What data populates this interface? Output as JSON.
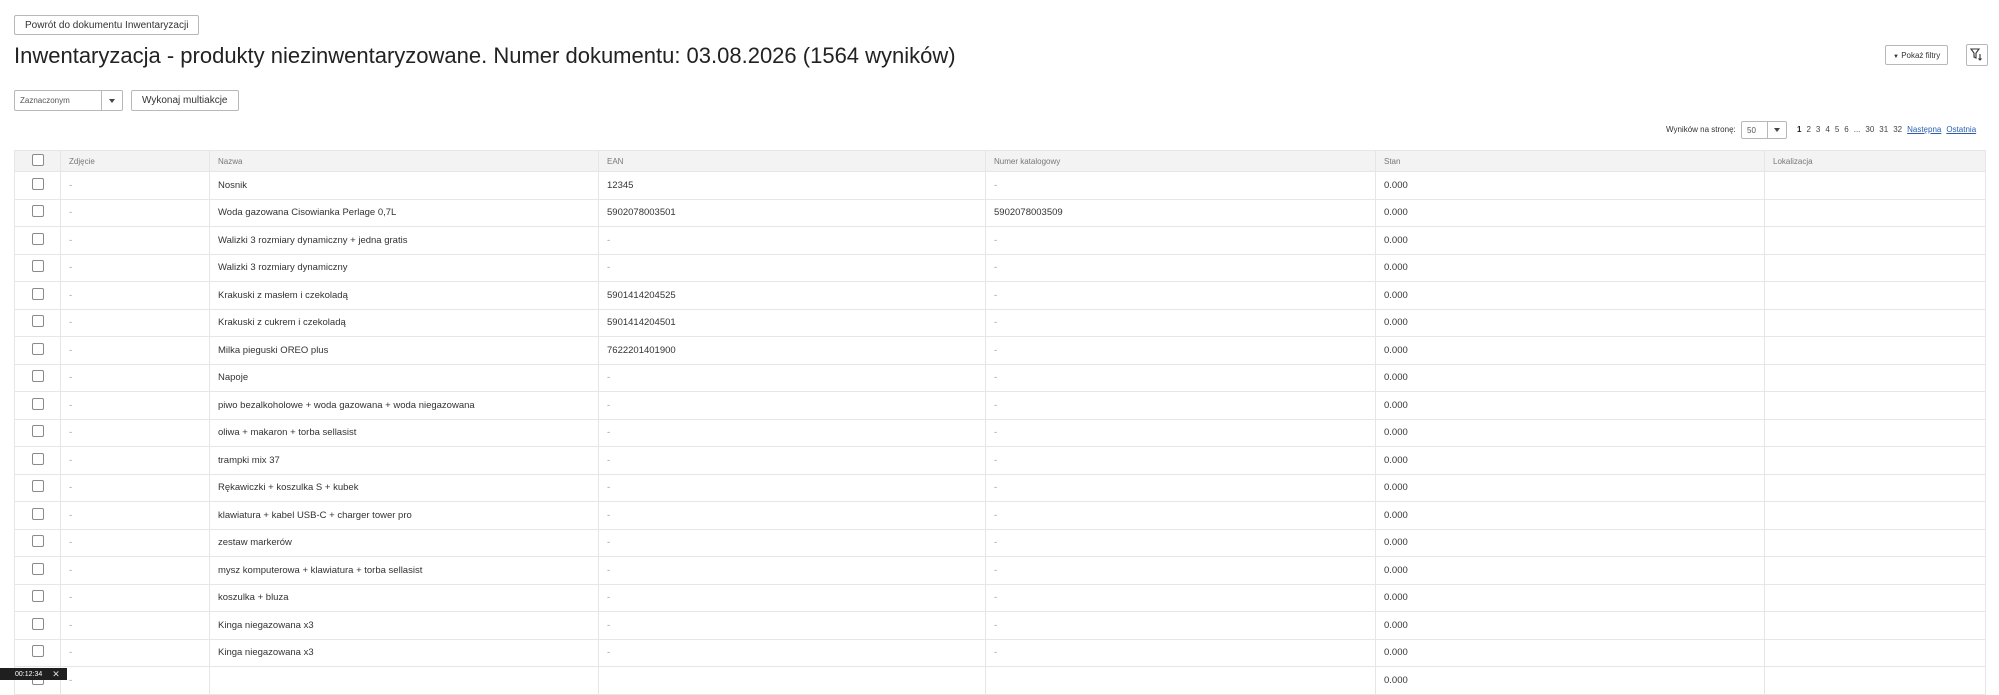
{
  "header": {
    "back_label": "Powrót do dokumentu Inwentaryzacji",
    "title": "Inwentaryzacja - produkty niezinwentaryzowane. Numer dokumentu: 03.08.2026 (1564 wyników)",
    "show_filters_label": "Pokaż filtry",
    "filter_icon": "filter-sort-icon"
  },
  "toolbar": {
    "mass_select_value": "Zaznaczonym",
    "multiaction_label": "Wykonaj multiakcje"
  },
  "pagination": {
    "per_page_label": "Wyników na stronę:",
    "per_page_value": "50",
    "pages": [
      "1",
      "2",
      "3",
      "4",
      "5",
      "6"
    ],
    "ellipsis": "...",
    "last_pages": [
      "30",
      "31",
      "32"
    ],
    "next_label": "Następna",
    "last_label": "Ostatnia"
  },
  "table": {
    "columns": [
      "Zdjęcie",
      "Nazwa",
      "EAN",
      "Numer katalogowy",
      "Stan",
      "Lokalizacja"
    ],
    "rows": [
      {
        "photo": "-",
        "name": "Nosnik",
        "ean": "12345",
        "catalog": "-",
        "stock": "0.000",
        "location": ""
      },
      {
        "photo": "-",
        "name": "Woda gazowana Cisowianka Perlage 0,7L",
        "ean": "5902078003501",
        "catalog": "5902078003509",
        "stock": "0.000",
        "location": ""
      },
      {
        "photo": "-",
        "name": "Walizki 3 rozmiary dynamiczny + jedna gratis",
        "ean": "-",
        "catalog": "-",
        "stock": "0.000",
        "location": ""
      },
      {
        "photo": "-",
        "name": "Walizki 3 rozmiary dynamiczny",
        "ean": "-",
        "catalog": "-",
        "stock": "0.000",
        "location": ""
      },
      {
        "photo": "-",
        "name": "Krakuski z masłem i czekoladą",
        "ean": "5901414204525",
        "catalog": "-",
        "stock": "0.000",
        "location": ""
      },
      {
        "photo": "-",
        "name": "Krakuski z cukrem i czekoladą",
        "ean": "5901414204501",
        "catalog": "-",
        "stock": "0.000",
        "location": ""
      },
      {
        "photo": "-",
        "name": "Milka pieguski OREO plus",
        "ean": "7622201401900",
        "catalog": "-",
        "stock": "0.000",
        "location": ""
      },
      {
        "photo": "-",
        "name": "Napoje",
        "ean": "-",
        "catalog": "-",
        "stock": "0.000",
        "location": ""
      },
      {
        "photo": "-",
        "name": "piwo bezalkoholowe + woda gazowana + woda niegazowana",
        "ean": "-",
        "catalog": "-",
        "stock": "0.000",
        "location": ""
      },
      {
        "photo": "-",
        "name": "oliwa + makaron + torba sellasist",
        "ean": "-",
        "catalog": "-",
        "stock": "0.000",
        "location": ""
      },
      {
        "photo": "-",
        "name": "trampki mix 37",
        "ean": "-",
        "catalog": "-",
        "stock": "0.000",
        "location": ""
      },
      {
        "photo": "-",
        "name": "Rękawiczki + koszulka S + kubek",
        "ean": "-",
        "catalog": "-",
        "stock": "0.000",
        "location": ""
      },
      {
        "photo": "-",
        "name": "klawiatura + kabel USB-C + charger tower pro",
        "ean": "-",
        "catalog": "-",
        "stock": "0.000",
        "location": ""
      },
      {
        "photo": "-",
        "name": "zestaw markerów",
        "ean": "-",
        "catalog": "-",
        "stock": "0.000",
        "location": ""
      },
      {
        "photo": "-",
        "name": "mysz komputerowa + klawiatura + torba sellasist",
        "ean": "-",
        "catalog": "-",
        "stock": "0.000",
        "location": ""
      },
      {
        "photo": "-",
        "name": "koszulka + bluza",
        "ean": "-",
        "catalog": "-",
        "stock": "0.000",
        "location": ""
      },
      {
        "photo": "-",
        "name": "Kinga niegazowana x3",
        "ean": "-",
        "catalog": "-",
        "stock": "0.000",
        "location": ""
      },
      {
        "photo": "-",
        "name": "Kinga niegazowana x3",
        "ean": "-",
        "catalog": "-",
        "stock": "0.000",
        "location": ""
      },
      {
        "photo": "-",
        "name": "",
        "ean": "",
        "catalog": "",
        "stock": "0.000",
        "location": ""
      }
    ]
  },
  "timer": {
    "time": "00:12:34",
    "close_icon": "close-icon"
  }
}
